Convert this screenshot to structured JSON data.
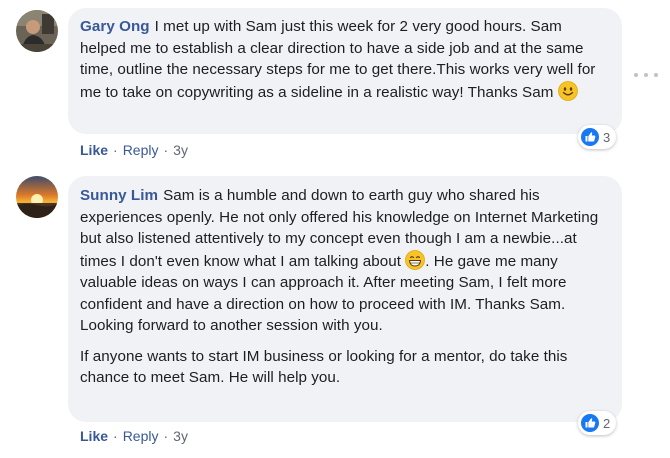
{
  "comments": [
    {
      "author": "Gary Ong",
      "text": "I met up with Sam just this week for 2 very good hours. Sam helped me to establish a clear direction to have a side job and at the same time, outline the necessary steps for me to get there.This works very well for me to take on copywriting as a sideline in a realistic way! Thanks Sam",
      "emoji": "slightly-smiling-face",
      "reaction_count": "3",
      "actions": {
        "like": "Like",
        "reply": "Reply",
        "separator": "·",
        "time": "3y"
      }
    },
    {
      "author": "Sunny Lim",
      "text_before_emoji": "Sam is a humble and down to earth guy who shared his experiences openly. He not only offered his knowledge on Internet Marketing but also listened attentively to my concept even though I am a newbie...at times I don't even know what I am talking about",
      "emoji": "grinning-face-with-sweat",
      "text_after_emoji": ". He gave me many valuable ideas on ways I can approach it. After meeting Sam, I felt more confident and have a direction on how to proceed with IM. Thanks Sam. Looking forward to another session with you.",
      "text_paragraph_2": "If anyone wants to start IM business or looking for a mentor, do take this chance to meet Sam. He will help you.",
      "reaction_count": "2",
      "actions": {
        "like": "Like",
        "reply": "Reply",
        "separator": "·",
        "time": "3y"
      }
    }
  ],
  "icons": {
    "like_reaction": "thumbs-up-icon",
    "more_options": "more-options-icon"
  },
  "colors": {
    "author_link": "#385898",
    "bubble_bg": "#f0f2f5",
    "like_blue": "#1877f2"
  }
}
